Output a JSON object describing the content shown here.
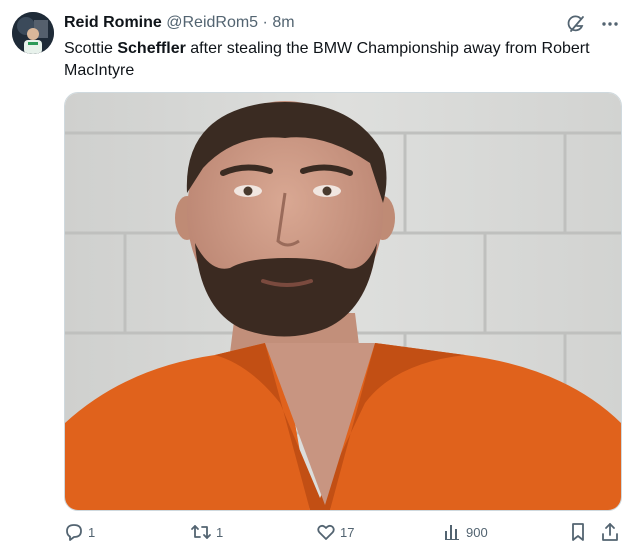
{
  "tweet": {
    "author_name": "Reid Romine",
    "author_handle": "@ReidRom5",
    "separator": "·",
    "time": "8m",
    "text_pre": "Scottie ",
    "text_bold": "Scheffler",
    "text_post": " after stealing the BMW Championship away from Robert MacIntyre"
  },
  "actions": {
    "replies": "1",
    "reposts": "1",
    "likes": "17",
    "views": "900"
  },
  "icons": {
    "top": [
      "grok-icon",
      "more-icon"
    ],
    "actions": [
      "reply-icon",
      "repost-icon",
      "like-icon",
      "views-icon",
      "bookmark-icon",
      "share-icon"
    ]
  },
  "colors": {
    "text": "#0f1419",
    "muted": "#536471",
    "jumpsuit": "#e0621c",
    "wall": "#d9dad8"
  }
}
